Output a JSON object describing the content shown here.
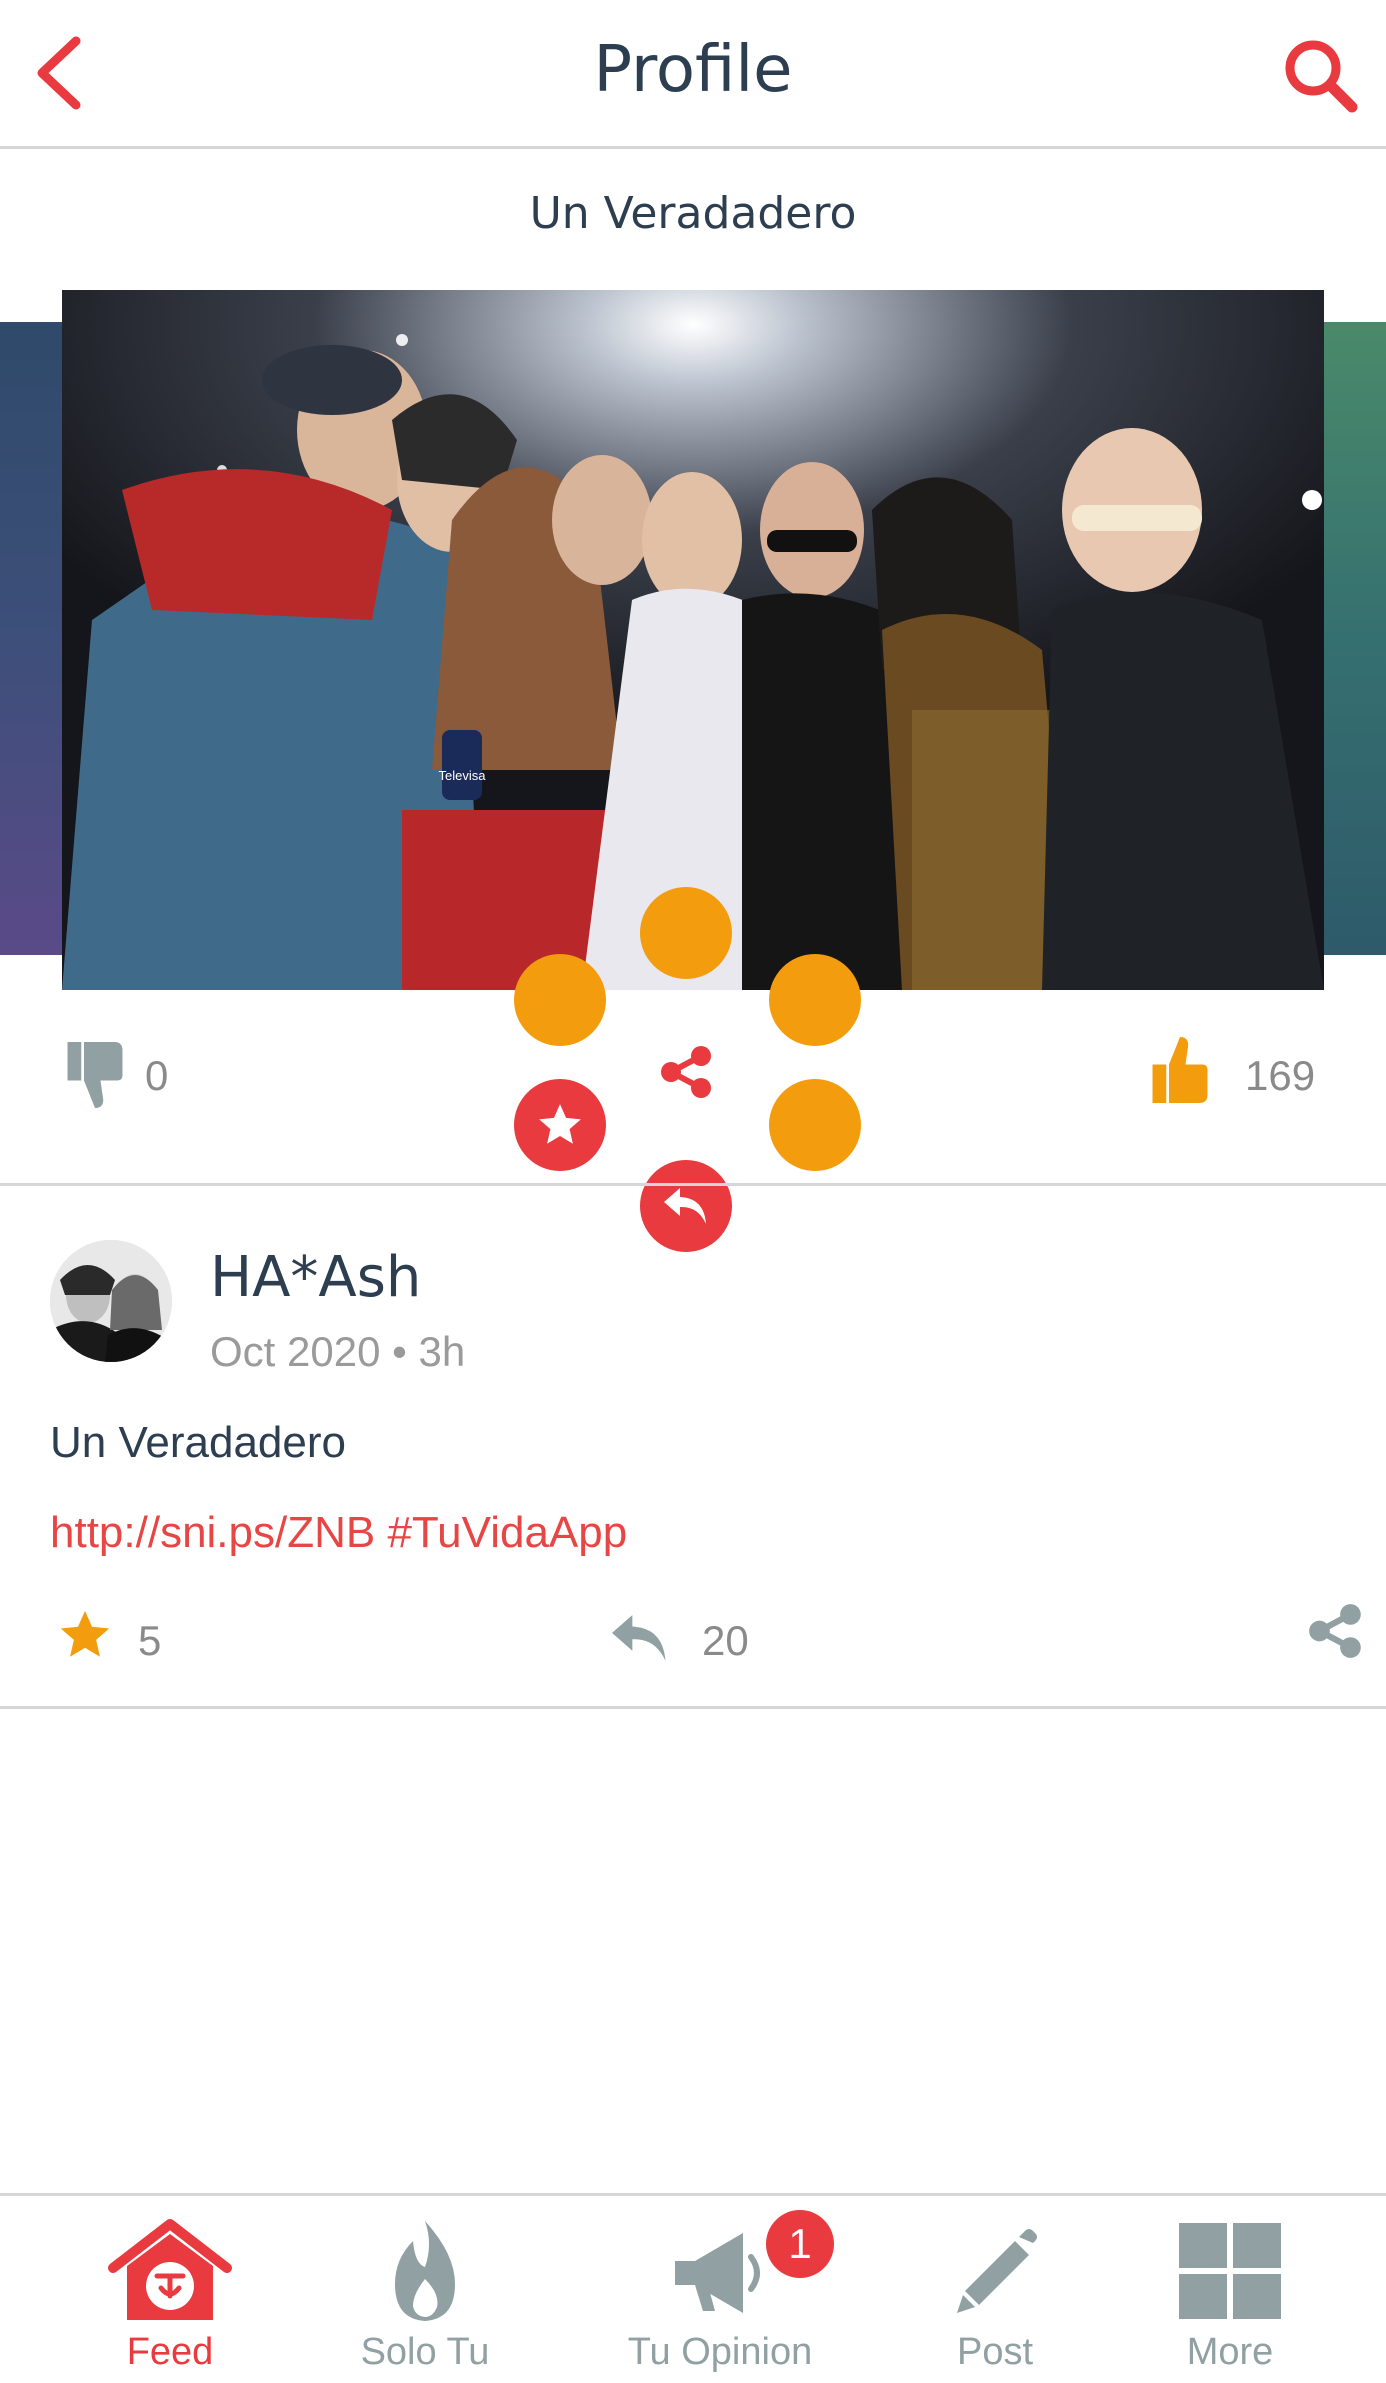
{
  "header": {
    "title": "Profile",
    "back_icon": "chevron-left-icon",
    "search_icon": "search-icon"
  },
  "post": {
    "caption": "Un Veradadero",
    "dislikes": "0",
    "likes": "169",
    "author": "HA*Ash",
    "meta": "Oct 2020 • 3h",
    "text": "Un Veradadero",
    "link": "http://sni.ps/ZNB #TuVidaApp",
    "favorites": "5",
    "replies": "20",
    "photo_sign_text": "Televisa"
  },
  "radial_menu": {
    "orb_count": 5,
    "items": [
      "favorite-icon",
      "share-icon",
      "reply-icon"
    ]
  },
  "tabbar": {
    "tabs": [
      {
        "label": "Feed",
        "icon": "home-icon",
        "active": true
      },
      {
        "label": "Solo Tu",
        "icon": "flame-icon"
      },
      {
        "label": "Tu Opinion",
        "icon": "megaphone-icon",
        "badge": "1"
      },
      {
        "label": "Post",
        "icon": "pencil-icon"
      },
      {
        "label": "More",
        "icon": "grid-icon"
      }
    ]
  },
  "colors": {
    "accent_red": "#e83a3f",
    "orange": "#f39c0d",
    "text_dark": "#2c3e50",
    "gray": "#90a0a3"
  }
}
